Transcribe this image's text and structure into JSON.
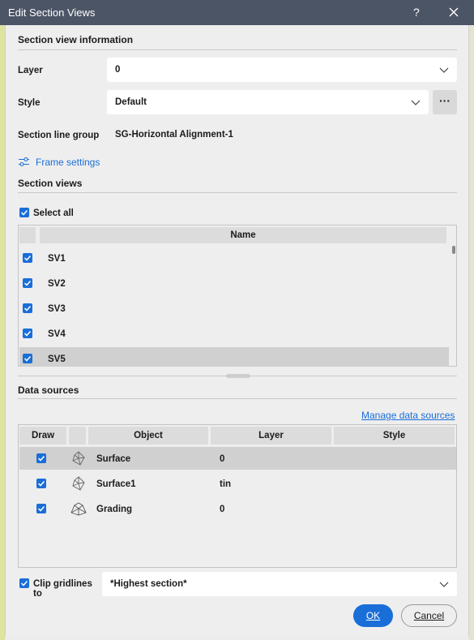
{
  "window": {
    "title": "Edit Section Views",
    "help_label": "?"
  },
  "section_info": {
    "header": "Section view information",
    "layer_label": "Layer",
    "layer_value": "0",
    "style_label": "Style",
    "style_value": "Default",
    "style_more_label": "···",
    "group_label": "Section line group",
    "group_value": "SG-Horizontal Alignment-1",
    "frame_settings_label": "Frame settings"
  },
  "section_views": {
    "header": "Section views",
    "select_all_label": "Select all",
    "select_all_checked": true,
    "column_name": "Name",
    "rows": [
      {
        "name": "SV1",
        "checked": true,
        "selected": false
      },
      {
        "name": "SV2",
        "checked": true,
        "selected": false
      },
      {
        "name": "SV3",
        "checked": true,
        "selected": false
      },
      {
        "name": "SV4",
        "checked": true,
        "selected": false
      },
      {
        "name": "SV5",
        "checked": true,
        "selected": true
      }
    ]
  },
  "data_sources": {
    "header": "Data sources",
    "manage_label": "Manage data sources",
    "columns": {
      "draw": "Draw",
      "object": "Object",
      "layer": "Layer",
      "style": "Style"
    },
    "rows": [
      {
        "object": "Surface",
        "layer": "0",
        "style": "",
        "checked": true,
        "selected": true,
        "icon": "surface-icon"
      },
      {
        "object": "Surface1",
        "layer": "tin",
        "style": "",
        "checked": true,
        "selected": false,
        "icon": "surface-icon"
      },
      {
        "object": "Grading",
        "layer": "0",
        "style": "",
        "checked": true,
        "selected": false,
        "icon": "grading-icon"
      }
    ]
  },
  "clip": {
    "label": "Clip gridlines to",
    "checked": true,
    "value": "*Highest section*"
  },
  "buttons": {
    "ok": "OK",
    "cancel": "Cancel"
  },
  "colors": {
    "accent": "#1a6ed8",
    "titlebar": "#4c5566"
  }
}
